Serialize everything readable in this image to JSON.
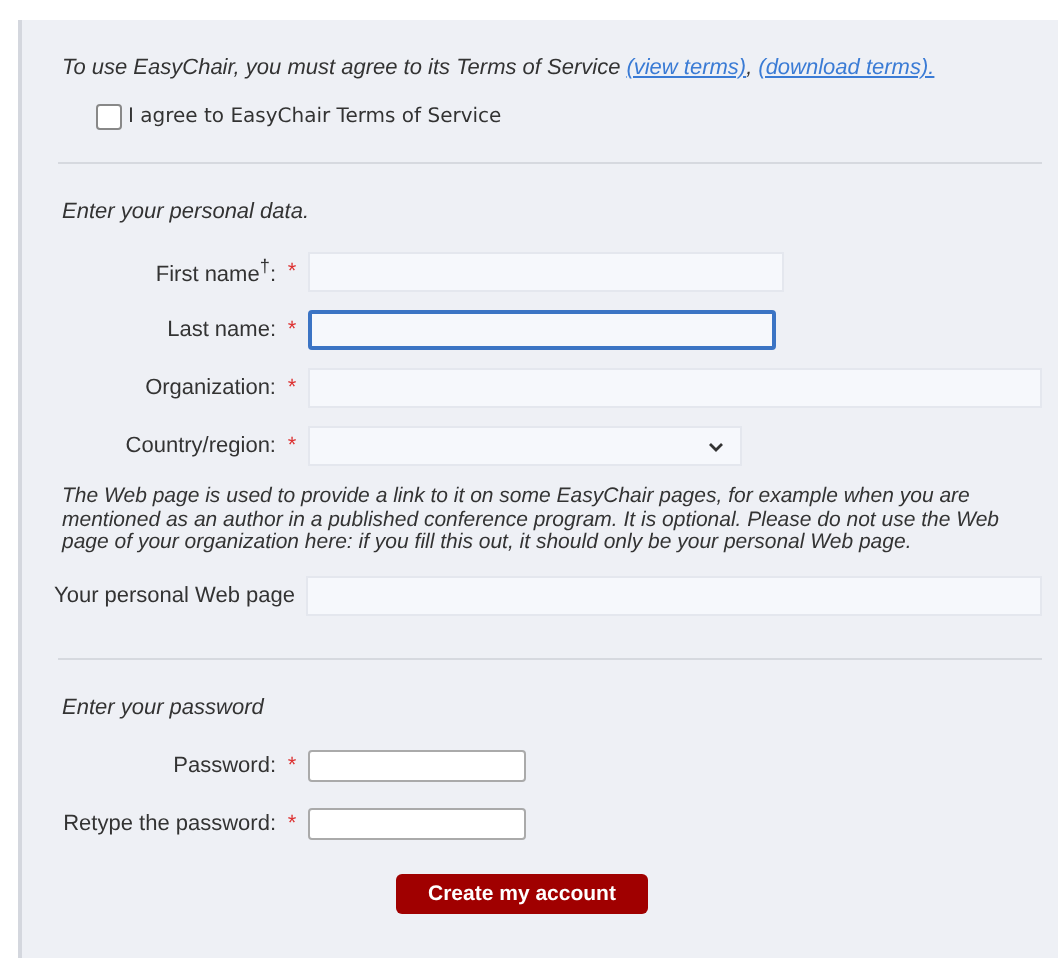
{
  "terms": {
    "text": "To use EasyChair, you must agree to its Terms of Service",
    "links": [
      "(view terms)",
      "(download terms)."
    ],
    "separator": ",",
    "checkbox": {
      "label": "I agree to EasyChair Terms of Service",
      "checked": false
    }
  },
  "personal": {
    "heading": "Enter your personal data.",
    "fields": [
      {
        "label": "First name$^{†}$:",
        "required_mark": "*",
        "kind": "text",
        "focused": false
      },
      {
        "label": "Last name:",
        "required_mark": "*",
        "kind": "text",
        "focused": true
      },
      {
        "label": "Organization:",
        "required_mark": "*",
        "kind": "text",
        "focused": false
      },
      {
        "label": "Country/region:",
        "required_mark": "*",
        "kind": "select",
        "focused": false
      }
    ],
    "note": "The Web page is used to provide a link to it on some EasyChair pages, for example when you are mentioned as an author in a published conference program. It is optional. Please do not use the Web page of your organization here: if you fill this out, it should only be your personal Web page.",
    "web_field": {
      "label": "Your personal Web page",
      "focused": false
    }
  },
  "password": {
    "heading": "Enter your password",
    "fields": [
      {
        "label": "Password:",
        "required_mark": "*",
        "focused": false
      },
      {
        "label": "Retype the password:",
        "required_mark": "*",
        "focused": false
      }
    ]
  },
  "button": "Create my account"
}
